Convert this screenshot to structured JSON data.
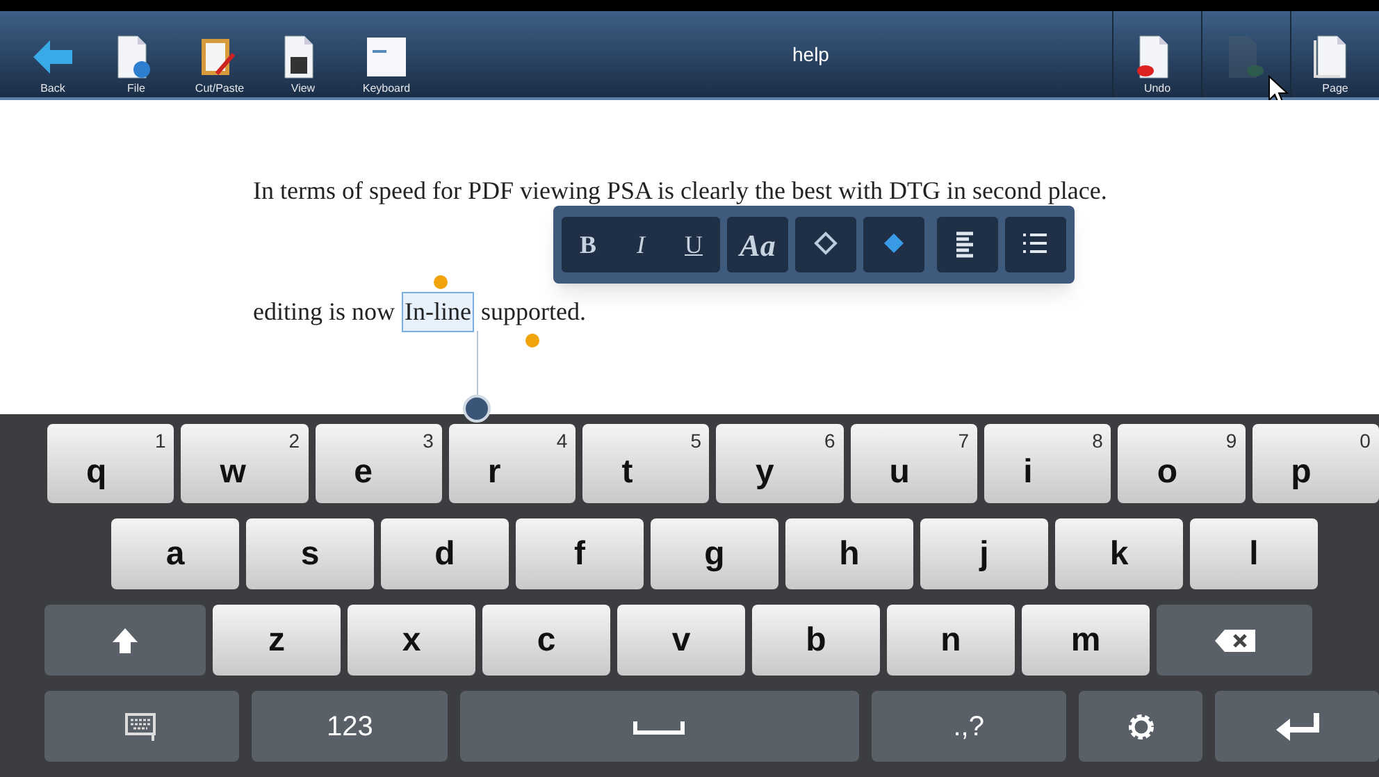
{
  "toolbar": {
    "title": "help",
    "left": [
      {
        "kind": "back",
        "label": "Back",
        "disabled": false
      },
      {
        "kind": "file",
        "label": "File",
        "disabled": false
      },
      {
        "kind": "cutpaste",
        "label": "Cut/Paste",
        "disabled": false
      },
      {
        "kind": "view",
        "label": "View",
        "disabled": false
      },
      {
        "kind": "keyboard",
        "label": "Keyboard",
        "disabled": false
      }
    ],
    "right": [
      {
        "kind": "undo",
        "label": "Undo",
        "disabled": false
      },
      {
        "kind": "redo",
        "disabled": true
      },
      {
        "kind": "page",
        "label": "Page",
        "disabled": false
      }
    ]
  },
  "document": {
    "paragraphs": [
      "In terms of speed for PDF viewing PSA is clearly the best with DTG in second place."
    ],
    "edit_line": {
      "before": "editing is now",
      "selected": "In-line",
      "after": "supported."
    }
  },
  "format_bar": {
    "groups": [
      [
        {
          "kind": "text",
          "label": "B"
        },
        {
          "kind": "text",
          "label": "I"
        },
        {
          "kind": "text",
          "label": "U"
        }
      ],
      [
        {
          "kind": "text",
          "label": "Aa"
        }
      ],
      [
        {
          "kind": "fill"
        }
      ],
      [
        {
          "kind": "color"
        }
      ],
      [
        {
          "kind": "align"
        }
      ],
      [
        {
          "kind": "list"
        }
      ]
    ]
  },
  "keyboard": {
    "rows": [
      [
        {
          "kind": "letter",
          "label": "q",
          "hint": "1"
        },
        {
          "kind": "letter",
          "label": "w",
          "hint": "2"
        },
        {
          "kind": "letter",
          "label": "e",
          "hint": "3"
        },
        {
          "kind": "letter",
          "label": "r",
          "hint": "4"
        },
        {
          "kind": "letter",
          "label": "t",
          "hint": "5"
        },
        {
          "kind": "letter",
          "label": "y",
          "hint": "6"
        },
        {
          "kind": "letter",
          "label": "u",
          "hint": "7"
        },
        {
          "kind": "letter",
          "label": "i",
          "hint": "8"
        },
        {
          "kind": "letter",
          "label": "o",
          "hint": "9"
        },
        {
          "kind": "letter",
          "label": "p",
          "hint": "0"
        }
      ],
      [
        {
          "kind": "letter",
          "label": "a"
        },
        {
          "kind": "letter",
          "label": "s"
        },
        {
          "kind": "letter",
          "label": "d"
        },
        {
          "kind": "letter",
          "label": "f"
        },
        {
          "kind": "letter",
          "label": "g"
        },
        {
          "kind": "letter",
          "label": "h"
        },
        {
          "kind": "letter",
          "label": "j"
        },
        {
          "kind": "letter",
          "label": "k"
        },
        {
          "kind": "letter",
          "label": "l"
        }
      ],
      [
        {
          "kind": "shift"
        },
        {
          "kind": "letter",
          "label": "z"
        },
        {
          "kind": "letter",
          "label": "x"
        },
        {
          "kind": "letter",
          "label": "c"
        },
        {
          "kind": "letter",
          "label": "v"
        },
        {
          "kind": "letter",
          "label": "b"
        },
        {
          "kind": "letter",
          "label": "n"
        },
        {
          "kind": "letter",
          "label": "m"
        },
        {
          "kind": "backspace"
        }
      ],
      [
        {
          "kind": "switch"
        },
        {
          "kind": "mode",
          "label": "123"
        },
        {
          "kind": "space"
        },
        {
          "kind": "mode",
          "label": ".,?"
        },
        {
          "kind": "settings"
        },
        {
          "kind": "enter"
        }
      ]
    ]
  }
}
